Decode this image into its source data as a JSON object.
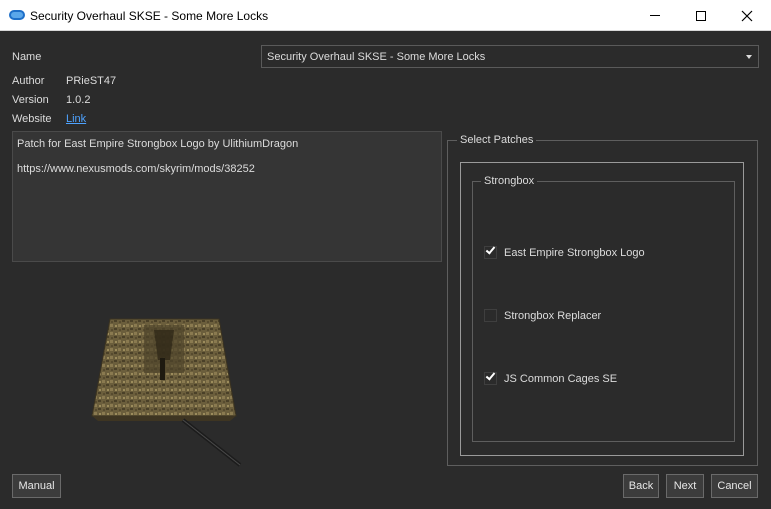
{
  "window": {
    "title": "Security Overhaul SKSE - Some More Locks",
    "controls": {
      "minimize": "—",
      "maximize": "☐",
      "close": "✕"
    }
  },
  "info": {
    "name_label": "Name",
    "name_value": "Security Overhaul SKSE - Some More Locks",
    "author_label": "Author",
    "author_value": "PRieST47",
    "version_label": "Version",
    "version_value": "1.0.2",
    "website_label": "Website",
    "website_link": "Link"
  },
  "description": {
    "line1": "Patch for East Empire Strongbox Logo by UlithiumDragon",
    "line2": "https://www.nexusmods.com/skyrim/mods/38252"
  },
  "patches": {
    "title": "Select Patches",
    "group_title": "Strongbox",
    "options": [
      {
        "label": "East Empire Strongbox Logo",
        "checked": true
      },
      {
        "label": "Strongbox Replacer",
        "checked": false
      },
      {
        "label": "JS Common Cages SE",
        "checked": true
      }
    ]
  },
  "buttons": {
    "manual": "Manual",
    "back": "Back",
    "next": "Next",
    "cancel": "Cancel"
  },
  "colors": {
    "background": "#2b2b2b",
    "link": "#4ea3ff",
    "text": "#dcdcdc"
  }
}
